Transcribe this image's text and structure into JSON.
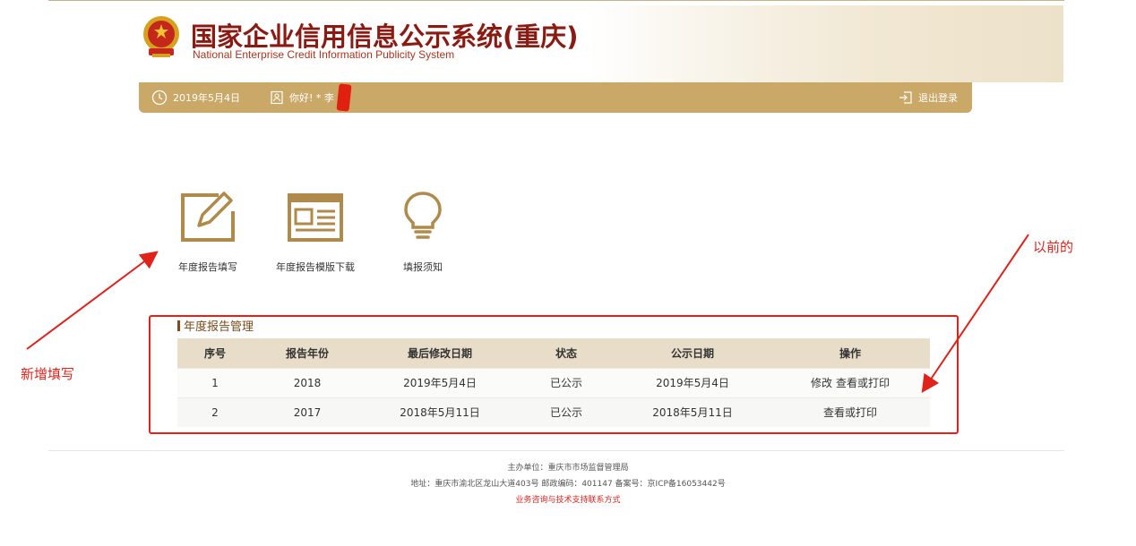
{
  "header": {
    "title": "国家企业信用信息公示系统(重庆)",
    "title_en": "National Enterprise Credit Information Publicity System"
  },
  "userbar": {
    "date": "2019年5月4日",
    "greeting": "你好! * 李",
    "logout": "退出登录"
  },
  "tools": [
    {
      "label": "年度报告填写",
      "icon": "edit-icon"
    },
    {
      "label": "年度报告模版下载",
      "icon": "template-download-icon"
    },
    {
      "label": "填报须知",
      "icon": "lightbulb-icon"
    }
  ],
  "section": {
    "title": "年度报告管理"
  },
  "table": {
    "headers": [
      "序号",
      "报告年份",
      "最后修改日期",
      "状态",
      "公示日期",
      "操作"
    ],
    "rows": [
      {
        "no": "1",
        "year": "2018",
        "modified": "2019年5月4日",
        "status": "已公示",
        "published": "2019年5月4日",
        "ops": [
          "修改",
          "查看或打印"
        ]
      },
      {
        "no": "2",
        "year": "2017",
        "modified": "2018年5月11日",
        "status": "已公示",
        "published": "2018年5月11日",
        "ops": [
          "查看或打印"
        ]
      }
    ]
  },
  "annotations": {
    "left": "新增填写",
    "right": "以前的"
  },
  "footer": {
    "line1": "主办单位：重庆市市场监督管理局",
    "line2": "地址：重庆市渝北区龙山大道403号 邮政编码：401147 备案号：京ICP备16053442号",
    "contact": "业务咨询与技术支持联系方式"
  },
  "colors": {
    "brand_red": "#8b1a12",
    "gold": "#c9a868",
    "annotation_red": "#e0221b",
    "link_blue": "#1a33c8"
  }
}
